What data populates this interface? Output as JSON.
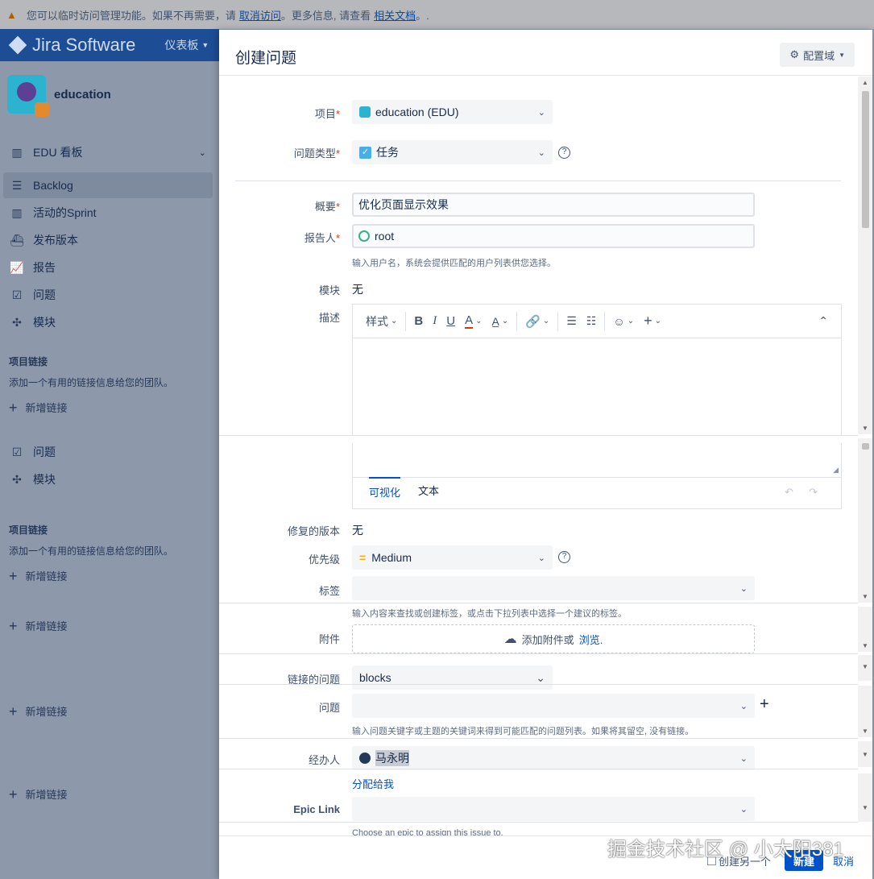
{
  "banner": {
    "prefix": "您可以临时访问管理功能。如果不再需要，请",
    "link1": "取消访问",
    "middle": "。更多信息, 请查看",
    "link2": "相关文档",
    "suffix": "。."
  },
  "topnav": {
    "product": "Jira Software",
    "dashboard": "仪表板"
  },
  "sidebar": {
    "project_name": "education",
    "items": [
      {
        "label": "EDU 看板",
        "icon": "board-icon"
      },
      {
        "label": "Backlog",
        "icon": "backlog-icon"
      },
      {
        "label": "活动的Sprint",
        "icon": "sprint-icon"
      },
      {
        "label": "发布版本",
        "icon": "ship-icon"
      },
      {
        "label": "报告",
        "icon": "chart-icon"
      },
      {
        "label": "问题",
        "icon": "issues-icon"
      },
      {
        "label": "模块",
        "icon": "puzzle-icon"
      }
    ],
    "links_heading": "项目链接",
    "links_text": "添加一个有用的链接信息给您的团队。",
    "add_link": "新增链接",
    "dup_items": [
      {
        "label": "问题"
      },
      {
        "label": "模块"
      }
    ]
  },
  "dialog": {
    "title": "创建问题",
    "config_button": "配置域",
    "fields": {
      "project_label": "项目",
      "project_value": "education (EDU)",
      "issue_type_label": "问题类型",
      "issue_type_value": "任务",
      "summary_label": "概要",
      "summary_value": "优化页面显示效果",
      "reporter_label": "报告人",
      "reporter_value": "root",
      "reporter_hint": "输入用户名，系统会提供匹配的用户列表供您选择。",
      "component_label": "模块",
      "component_value": "无",
      "description_label": "描述",
      "fix_version_label": "修复的版本",
      "fix_version_value": "无",
      "priority_label": "优先级",
      "priority_value": "Medium",
      "labels_label": "标签",
      "labels_hint": "输入内容来查找或创建标签，或点击下拉列表中选择一个建议的标签。",
      "attachment_label": "附件",
      "attachment_text": "添加附件或",
      "attachment_browse": "浏览.",
      "linked_label": "链接的问题",
      "linked_value": "blocks",
      "issue_label": "问题",
      "issue_hint": "输入问题关键字或主题的关键词来得到可能匹配的问题列表。如果将其留空, 没有链接。",
      "assignee_label": "经办人",
      "assignee_value": "马永明",
      "assign_to_me": "分配给我",
      "epic_label": "Epic Link",
      "epic_hint": "Choose an epic to assign this issue to."
    },
    "editor": {
      "style_label": "样式",
      "tab_visual": "可视化",
      "tab_text": "文本"
    },
    "footer": {
      "create_another": "创建另一个",
      "create": "新建",
      "cancel": "取消"
    }
  },
  "watermark": "掘金技术社区 @ 小太阳381",
  "colors": {
    "primary": "#0052cc",
    "nav": "#1d4d95",
    "required": "#de350b"
  }
}
